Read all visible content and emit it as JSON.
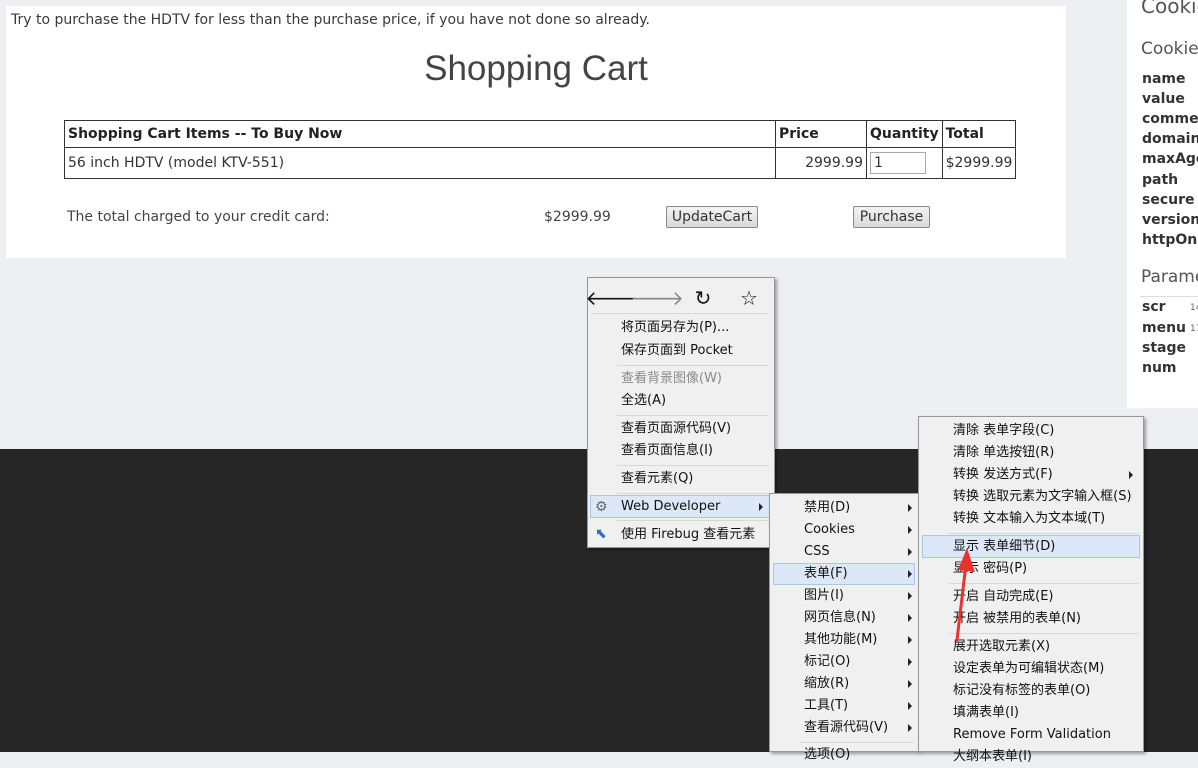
{
  "page": {
    "instructions": "Try to purchase the HDTV for less than the purchase price, if you have not done so already.",
    "title": "Shopping Cart"
  },
  "cart": {
    "headers": [
      "Shopping Cart Items -- To Buy Now",
      "Price",
      "Quantity",
      "Total"
    ],
    "rows": [
      {
        "item": "56 inch HDTV (model KTV-551)",
        "price": "2999.99",
        "quantity": "1",
        "total": "$2999.99"
      }
    ],
    "total_label": "The total charged to your credit card:",
    "total_value": "$2999.99",
    "update_button": "UpdateCart",
    "purchase_button": "Purchase"
  },
  "side_panel": {
    "title": "Cookie",
    "cookie_heading": "Cookie",
    "cookie_fields": [
      "name",
      "value",
      "comment",
      "domain",
      "maxAge",
      "path",
      "secure",
      "version",
      "httpOnly"
    ],
    "params_heading": "Parame",
    "param_fields": [
      "scr",
      "menu",
      "stage",
      "num"
    ],
    "param_values": [
      "14",
      "17",
      "",
      ""
    ]
  },
  "context_menu": {
    "nav_icons": [
      "back-arrow-icon",
      "forward-arrow-icon",
      "reload-icon",
      "bookmark-star-icon"
    ],
    "items": [
      {
        "label": "将页面另存为(P)..."
      },
      {
        "label": "保存页面到 Pocket"
      },
      {
        "label": "查看背景图像(W)"
      },
      {
        "label": "全选(A)"
      },
      {
        "label": "查看页面源代码(V)"
      },
      {
        "label": "查看页面信息(I)"
      },
      {
        "label": "查看元素(Q)"
      },
      {
        "label": "Web Developer"
      },
      {
        "label": "使用 Firebug 查看元素"
      }
    ]
  },
  "webdev_submenu": {
    "items": [
      {
        "label": "禁用(D)"
      },
      {
        "label": "Cookies"
      },
      {
        "label": "CSS"
      },
      {
        "label": "表单(F)"
      },
      {
        "label": "图片(I)"
      },
      {
        "label": "网页信息(N)"
      },
      {
        "label": "其他功能(M)"
      },
      {
        "label": "标记(O)"
      },
      {
        "label": "缩放(R)"
      },
      {
        "label": "工具(T)"
      },
      {
        "label": "查看源代码(V)"
      },
      {
        "label": "选项(O)"
      }
    ]
  },
  "forms_submenu": {
    "items": [
      {
        "label": "清除 表单字段(C)"
      },
      {
        "label": "清除 单选按钮(R)"
      },
      {
        "label": "转换 发送方式(F)"
      },
      {
        "label": "转换 选取元素为文字输入框(S)"
      },
      {
        "label": "转换 文本输入为文本域(T)"
      },
      {
        "label": "显示 表单细节(D)"
      },
      {
        "label": "显示 密码(P)"
      },
      {
        "label": "开启 自动完成(E)"
      },
      {
        "label": "开启 被禁用的表单(N)"
      },
      {
        "label": "展开选取元素(X)"
      },
      {
        "label": "设定表单为可编辑状态(M)"
      },
      {
        "label": "标记没有标签的表单(O)"
      },
      {
        "label": "填满表单(I)"
      },
      {
        "label": "Remove Form Validation"
      },
      {
        "label": "大纲本表单(I)"
      }
    ]
  },
  "colors": {
    "dark_background": "#262626",
    "menu_highlight": "#dce8f7",
    "annotation_arrow": "#e8332f"
  }
}
